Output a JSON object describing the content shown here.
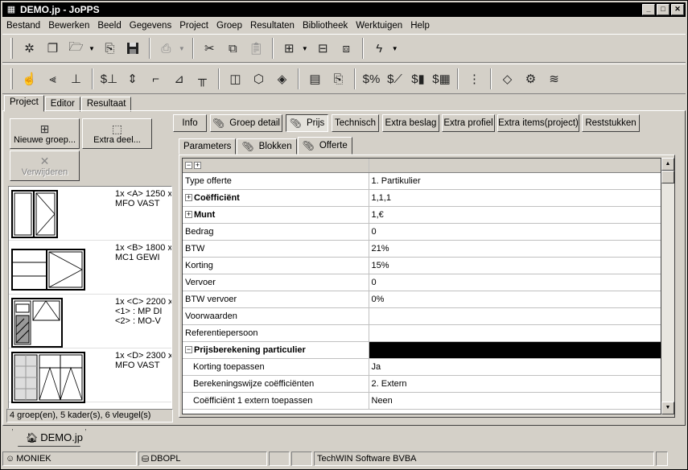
{
  "window": {
    "title": "DEMO.jp - JoPPS"
  },
  "menu": [
    "Bestand",
    "Bewerken",
    "Beeld",
    "Gegevens",
    "Project",
    "Groep",
    "Resultaten",
    "Bibliotheek",
    "Werktuigen",
    "Help"
  ],
  "main_tabs": [
    "Project",
    "Editor",
    "Resultaat"
  ],
  "left_panel": {
    "new_group_label": "Nieuwe groep...",
    "extra_part_label": "Extra deel...",
    "remove_label": "Verwijderen",
    "groups": [
      {
        "lines": [
          "1x <A> 1250 x",
          "MFO VAST"
        ]
      },
      {
        "lines": [
          "1x <B> 1800 x",
          "MC1 GEWI"
        ]
      },
      {
        "lines": [
          "1x <C> 2200 x",
          "<1> : MP DI",
          "<2> : MO-V"
        ]
      },
      {
        "lines": [
          "1x <D> 2300 x",
          "MFO VAST"
        ]
      }
    ],
    "status": "4 groep(en), 5 kader(s), 6 vleugel(s)"
  },
  "detail_buttons": {
    "info": "Info",
    "group_detail": "Groep detail",
    "price": "Prijs",
    "technical": "Technisch",
    "extra_fittings": "Extra beslag",
    "extra_profile": "Extra profiel",
    "extra_items": "Extra items(project)",
    "rest_pieces": "Reststukken"
  },
  "sub_tabs": [
    "Parameters",
    "Blokken",
    "Offerte"
  ],
  "grid_rows": [
    {
      "label": "Type offerte",
      "value": "1. Partikulier"
    },
    {
      "label": "Coëfficiënt",
      "value": "1,1,1"
    },
    {
      "label": "Munt",
      "value": "1,€"
    },
    {
      "label": "Bedrag",
      "value": "0"
    },
    {
      "label": "BTW",
      "value": "21%"
    },
    {
      "label": "Korting",
      "value": "15%"
    },
    {
      "label": "Vervoer",
      "value": "0"
    },
    {
      "label": "BTW vervoer",
      "value": "0%"
    },
    {
      "label": "Voorwaarden",
      "value": ""
    },
    {
      "label": "Referentiepersoon",
      "value": ""
    },
    {
      "label": "Prijsberekening particulier",
      "value": ""
    },
    {
      "label": "Korting toepassen",
      "value": "Ja"
    },
    {
      "label": "Berekeningswijze coëfficiënten",
      "value": "2. Extern"
    },
    {
      "label": "Coëfficiënt 1 extern toepassen",
      "value": "Neen"
    }
  ],
  "doc_tab": "DEMO.jp",
  "statusbar": {
    "user": "MONIEK",
    "db": "DBOPL",
    "company": "TechWIN Software BVBA"
  }
}
